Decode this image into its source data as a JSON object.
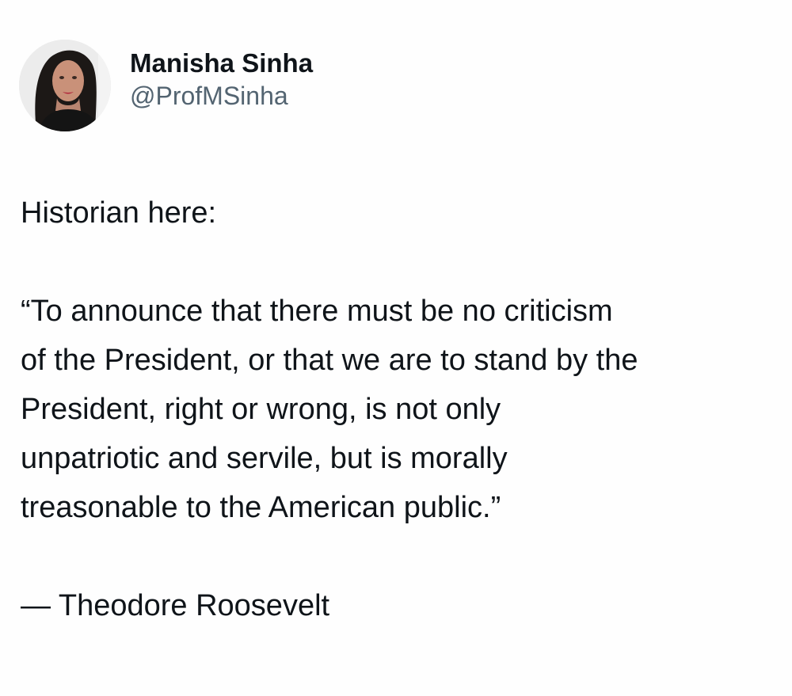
{
  "tweet": {
    "author": {
      "display_name": "Manisha Sinha",
      "handle": "@ProfMSinha"
    },
    "intro": "Historian here:",
    "quote_lines": [
      "“To announce that there must be no criticism",
      "of the President, or that we are to stand by the",
      "President, right or wrong, is not only",
      "unpatriotic and servile, but is morally",
      "treasonable to the American public.”"
    ],
    "attribution": "— Theodore Roosevelt"
  },
  "colors": {
    "text": "#0f1419",
    "handle": "#536471",
    "background": "#fefefe"
  }
}
